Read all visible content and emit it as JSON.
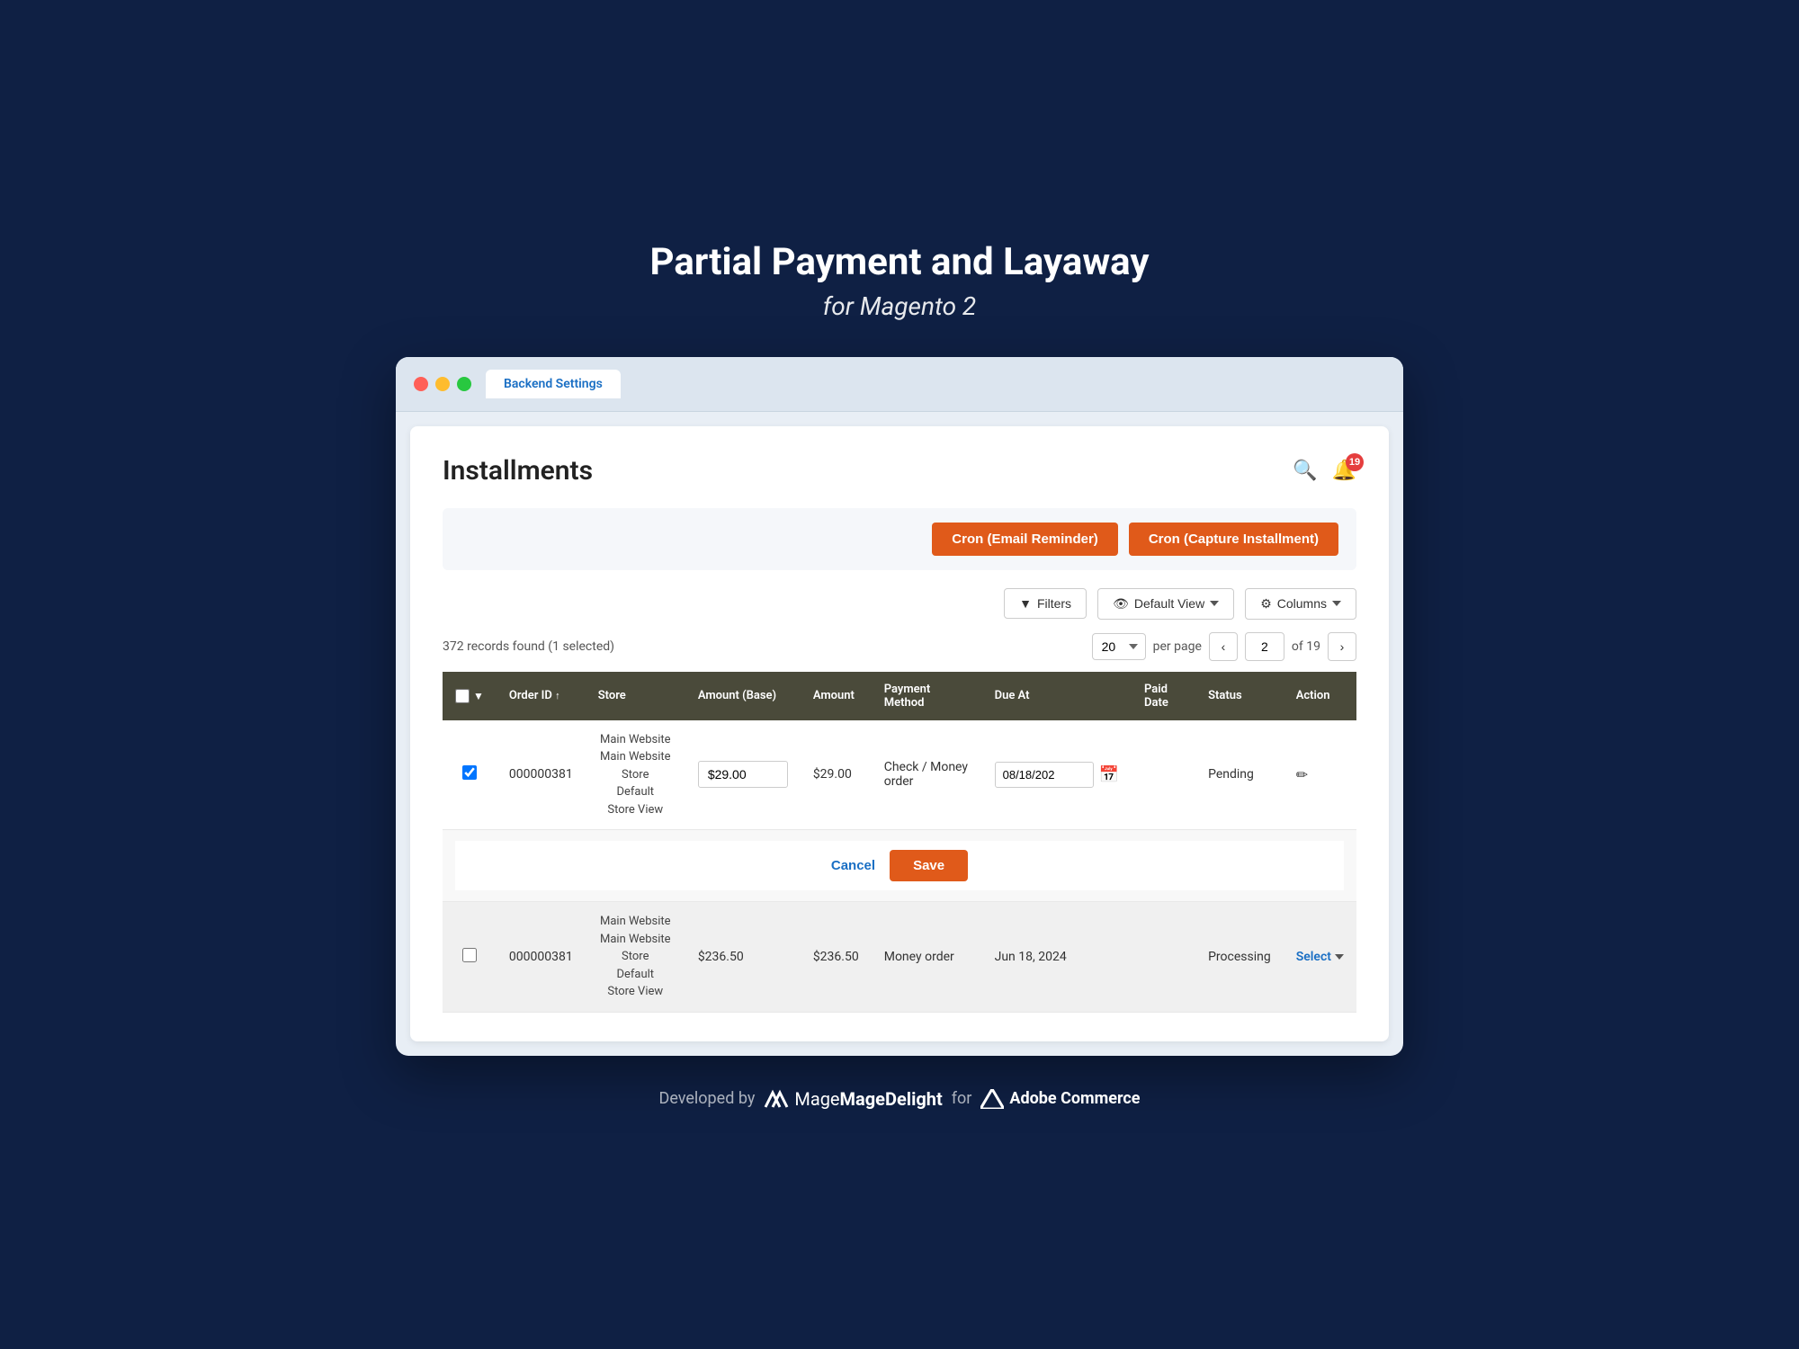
{
  "page": {
    "title": "Partial Payment and Layaway",
    "subtitle": "for Magento 2"
  },
  "browser": {
    "tab_label": "Backend Settings"
  },
  "content": {
    "page_title": "Installments",
    "notification_count": "19",
    "buttons": {
      "cron_email": "Cron (Email Reminder)",
      "cron_capture": "Cron (Capture Installment)",
      "filters": "Filters",
      "default_view": "Default View",
      "columns": "Columns",
      "cancel": "Cancel",
      "save": "Save",
      "select": "Select"
    },
    "pagination": {
      "records_info": "372 records found (1 selected)",
      "per_page": "20",
      "per_page_label": "per page",
      "current_page": "2",
      "total_pages": "19",
      "of_label": "of"
    },
    "table": {
      "headers": [
        "",
        "Order ID",
        "Store",
        "Amount (Base)",
        "Amount",
        "Payment Method",
        "Due At",
        "Paid Date",
        "Status",
        "Action"
      ],
      "rows": [
        {
          "id": "row1",
          "checked": true,
          "order_id": "000000381",
          "store": "Main Website\nMain Website Store\nDefault\nStore View",
          "amount_base": "$29.00",
          "amount": "$29.00",
          "payment_method": "Check / Money order",
          "due_at": "08/18/202",
          "paid_date": "",
          "status": "Pending",
          "action": "edit",
          "editing": true
        },
        {
          "id": "row2",
          "checked": false,
          "order_id": "000000381",
          "store": "Main Website\nMain Website Store\nDefault\nStore View",
          "amount_base": "$236.50",
          "amount": "$236.50",
          "payment_method": "Money order",
          "due_at": "Jun 18, 2024",
          "paid_date": "",
          "status": "Processing",
          "action": "select",
          "editing": false
        }
      ]
    }
  },
  "footer": {
    "text": "Developed by",
    "brand": "MageDelight",
    "for_text": "for",
    "adobe_brand": "Adobe Commerce"
  }
}
